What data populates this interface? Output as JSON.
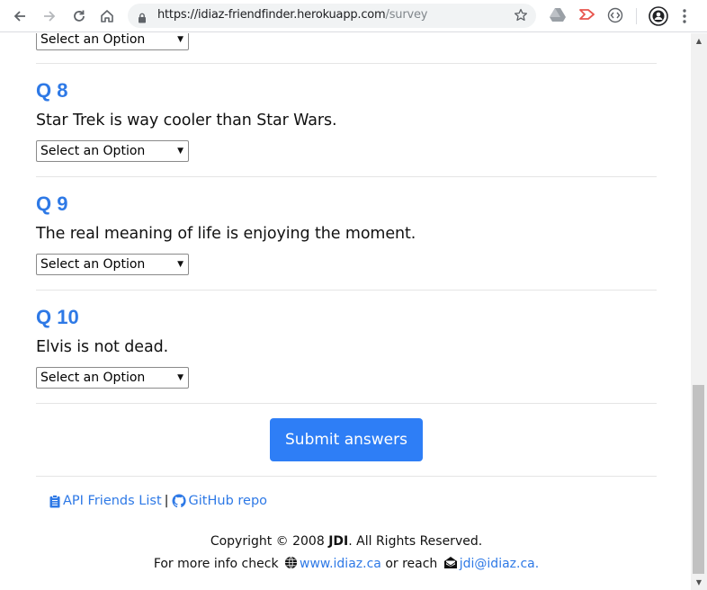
{
  "browser": {
    "url_host": "https://idiaz-friendfinder.herokuapp.com",
    "url_path": "/survey"
  },
  "survey": {
    "select_placeholder": "Select an Option",
    "questions": [
      {
        "number": "Q 8",
        "text": "Star Trek is way cooler than Star Wars.",
        "selected": "Select an Option"
      },
      {
        "number": "Q 9",
        "text": "The real meaning of life is enjoying the moment.",
        "selected": "Select an Option"
      },
      {
        "number": "Q 10",
        "text": "Elvis is not dead.",
        "selected": "Select an Option"
      }
    ],
    "submit_label": "Submit answers"
  },
  "footer": {
    "api_link": "API Friends List",
    "separator": "|",
    "github_link": "GitHub repo",
    "copyright_prefix": "Copyright © 2008",
    "copyright_brand": "JDI",
    "copyright_suffix": ". All Rights Reserved.",
    "info_prefix": "For more info check",
    "website": "www.idiaz.ca",
    "info_middle": "or reach",
    "email": "jdi@idiaz.ca."
  },
  "colors": {
    "accent": "#2e79e6",
    "button": "#2e7ef6"
  }
}
